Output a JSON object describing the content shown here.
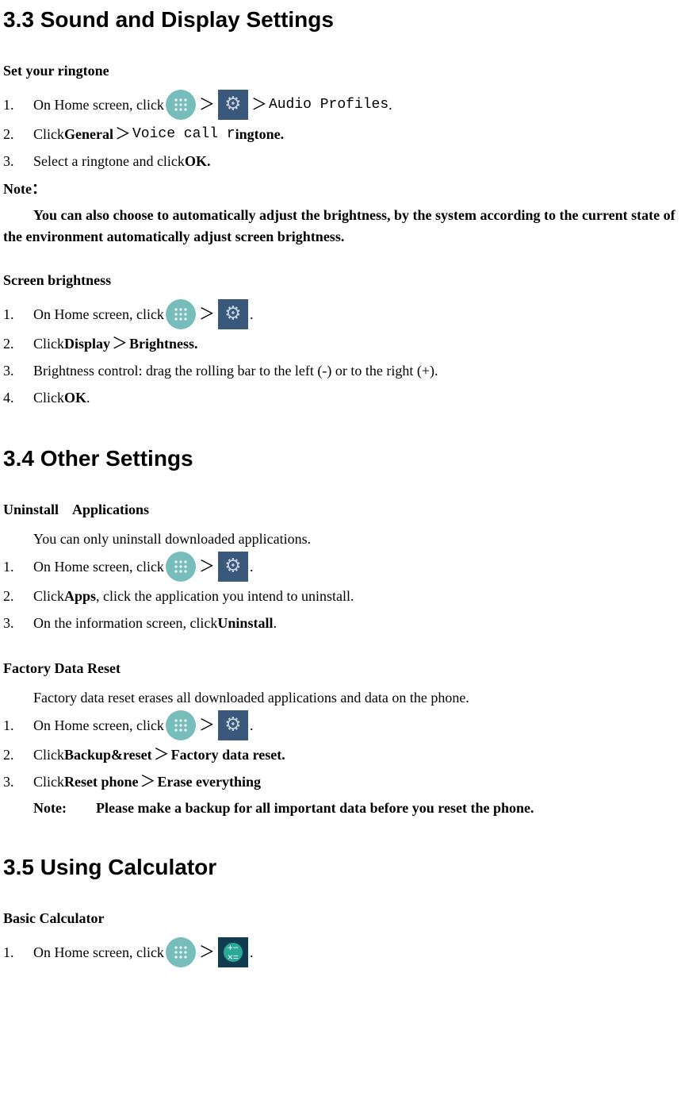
{
  "s33": {
    "title": "3.3 Sound and Display Settings",
    "ringtone": {
      "head": "Set your ringtone",
      "step1_pre": "On Home screen, click ",
      "step1_mid_gt": "＞",
      "step1_audio": "Audio Profiles",
      "step1_end": ".",
      "step2a": "Click ",
      "step2b": "General",
      "step2_gt": "＞",
      "step2c": "Voice call r",
      "step2d": "ingtone.",
      "step3a": "Select a ringtone and click ",
      "step3b": "OK."
    },
    "note": {
      "head": "Note：",
      "body": "You can also choose to automatically adjust the brightness, by the system according to the current state of the environment automatically adjust screen brightness."
    },
    "brightness": {
      "head": "Screen brightness",
      "step1_pre": "On Home screen, click",
      "step1_gt": "＞",
      "step1_end": ".",
      "step2a": "Click ",
      "step2b": "Display",
      "step2_gt": "＞",
      "step2c": "Brightness.",
      "step3": "Brightness control: drag the rolling bar to the left (-) or to the right (+).",
      "step4a": "Click ",
      "step4b": "OK",
      "step4c": "."
    }
  },
  "s34": {
    "title": "3.4 Other Settings",
    "uninstall": {
      "head": "Uninstall    Applications",
      "intro": "You can only uninstall downloaded applications.",
      "step1_pre": "On Home screen, click ",
      "step1_gt": "＞",
      "step1_end": ".",
      "step2a": "Click ",
      "step2b": "Apps",
      "step2c": ", click the application you intend to uninstall.",
      "step3a": "On the information screen, click ",
      "step3b": "Uninstall",
      "step3c": "."
    },
    "reset": {
      "head": "Factory Data Reset",
      "intro": "Factory data reset erases all downloaded applications and data on the phone.",
      "step1_pre": "On Home screen, click",
      "step1_gt": "＞",
      "step1_end": ".",
      "step2a": "Click ",
      "step2b": "Backup&reset ",
      "step2_gt": " ＞",
      "step2c": "Factory data reset.",
      "step3a": "Click ",
      "step3b": "Reset phone",
      "step3_gt": "＞",
      "step3c": "Erase everything",
      "note_a": "Note:",
      "note_b": "Please make a backup for all important data before you reset the phone."
    }
  },
  "s35": {
    "title": "3.5 Using Calculator",
    "basic": {
      "head": "Basic Calculator",
      "step1_pre": "On Home screen, click",
      "step1_gt": "＞",
      "step1_end": "."
    }
  }
}
